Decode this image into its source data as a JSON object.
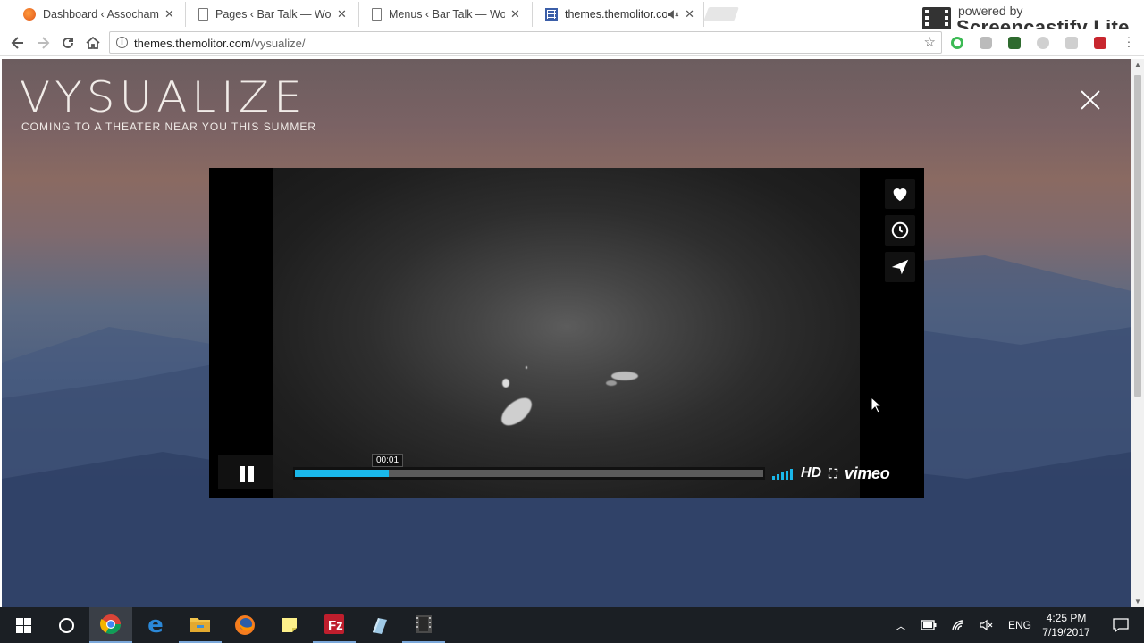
{
  "browser": {
    "tabs": [
      {
        "title": "Dashboard ‹ Assocham Pr",
        "icon": "favicon-orange-icon"
      },
      {
        "title": "Pages ‹ Bar Talk — WordPr",
        "icon": "document-icon"
      },
      {
        "title": "Menus ‹ Bar Talk — WordP",
        "icon": "document-icon"
      },
      {
        "title": "themes.themolitor.com",
        "icon": "grid-favicon-icon",
        "active": true,
        "muted": true
      }
    ],
    "close_tab": "✕",
    "url_host": "themes.themolitor.com",
    "url_path": "/vysualize/",
    "watermark_small": "powered by",
    "watermark_big": "Screencastify Lite"
  },
  "page": {
    "title": "VYSUALIZE",
    "subtitle": "COMING TO A THEATER NEAR YOU THIS SUMMER"
  },
  "player": {
    "time_tooltip": "00:01",
    "progress": 0.2,
    "hd_label": "HD",
    "brand": "vimeo",
    "side_buttons": [
      "heart-icon",
      "clock-icon",
      "send-icon"
    ]
  },
  "taskbar": {
    "language": "ENG",
    "time": "4:25 PM",
    "date": "7/19/2017"
  },
  "colors": {
    "accent": "#1ab7ea",
    "taskbar": "#1b1f24"
  }
}
